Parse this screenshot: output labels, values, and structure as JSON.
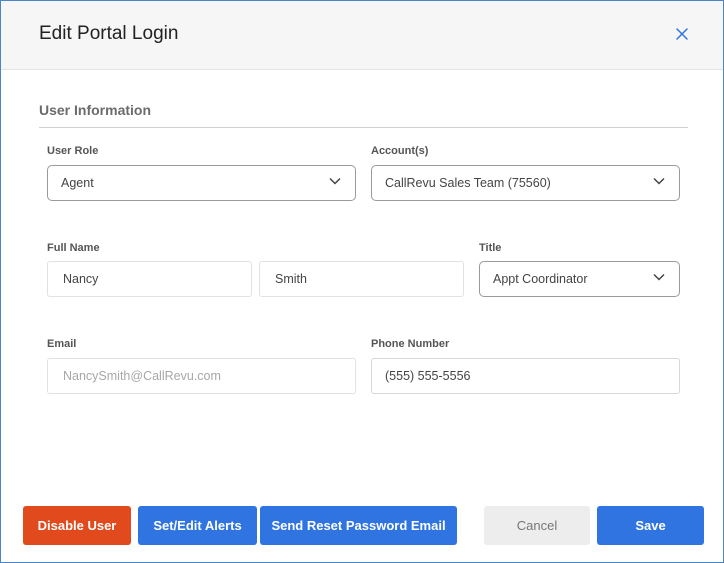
{
  "modal": {
    "title": "Edit Portal Login",
    "close_icon": "close-icon"
  },
  "section": {
    "title": "User Information"
  },
  "fields": {
    "user_role": {
      "label": "User Role",
      "value": "Agent"
    },
    "accounts": {
      "label": "Account(s)",
      "value": "CallRevu Sales Team (75560)"
    },
    "full_name": {
      "label": "Full Name",
      "first": "Nancy",
      "last": "Smith"
    },
    "title": {
      "label": "Title",
      "value": "Appt Coordinator"
    },
    "email": {
      "label": "Email",
      "value": "NancySmith@CallRevu.com"
    },
    "phone": {
      "label": "Phone Number",
      "value": "(555) 555-5556"
    }
  },
  "buttons": {
    "disable_user": "Disable User",
    "set_edit_alerts": "Set/Edit Alerts",
    "send_reset": "Send Reset Password Email",
    "cancel": "Cancel",
    "save": "Save"
  },
  "colors": {
    "primary": "#2f74e0",
    "danger": "#e04a1c",
    "neutral": "#ededed"
  }
}
